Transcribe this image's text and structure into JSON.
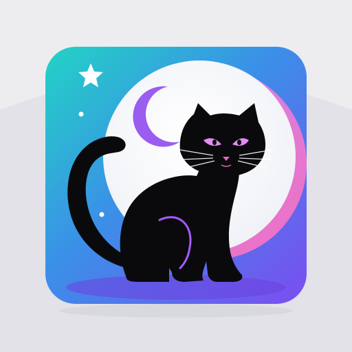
{
  "icon": {
    "subject": "black-cat-moon-app-icon",
    "colors": {
      "page_background": "#ededf0",
      "backdrop_shape": "#e2e2e8",
      "gradient_top_left": "#22d3c5",
      "gradient_mid": "#3b8fe8",
      "gradient_bottom_right": "#7b4df0",
      "moon": "#fbfbfd",
      "moon_rim": "#f06fc0",
      "crescent": "#9b5cf0",
      "star": "#ffffff",
      "cat": "#0a0a0c",
      "cat_eyes": "#e38cf5",
      "cat_nose": "#e06ab8",
      "cat_accent": "#a65cff",
      "whiskers": "#ffffff"
    }
  }
}
